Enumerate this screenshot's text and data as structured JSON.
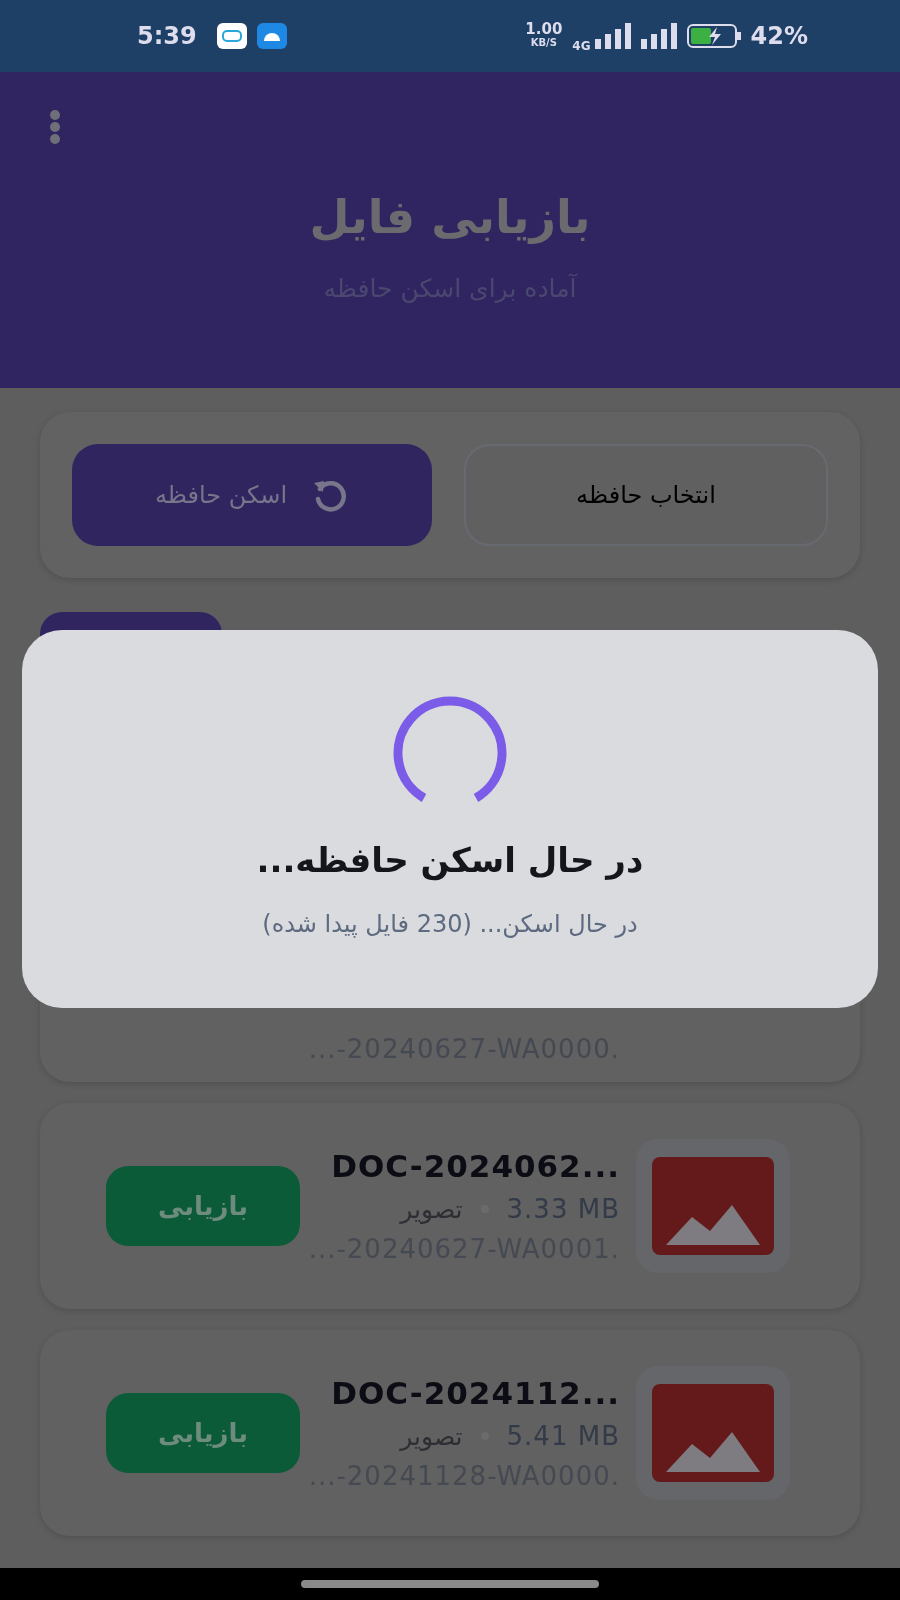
{
  "status_bar": {
    "time": "5:39",
    "speed_value": "1.00",
    "speed_unit": "KB/S",
    "network": "4G",
    "battery": "42%"
  },
  "header": {
    "title": "بازیابی فایل",
    "subtitle": "آماده برای اسکن حافظه"
  },
  "controls": [
    {
      "kind": "select",
      "label": "انتخاب حافظه"
    },
    {
      "kind": "scan",
      "label": "اسکن حافظه"
    }
  ],
  "files": [
    {
      "path": "...-20240627-WA0000."
    },
    {
      "name": "DOC-2024062...",
      "size": "3.33 MB",
      "type": "تصویر",
      "path": "...-20240627-WA0001.",
      "action": "بازیابی"
    },
    {
      "name": "DOC-2024112...",
      "size": "5.41 MB",
      "type": "تصویر",
      "path": "...-20241128-WA0000.",
      "action": "بازیابی"
    }
  ],
  "dialog": {
    "title": "در حال اسکن حافظه...",
    "message": "در حال اسکن... (230 فایل پیدا شده)"
  }
}
